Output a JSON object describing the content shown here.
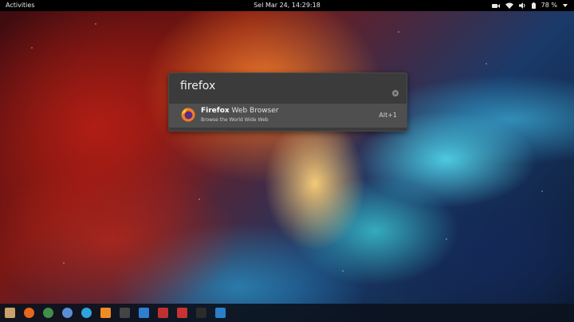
{
  "topbar": {
    "activities": "Activities",
    "clock": "Sel Mar 24, 14:29:18",
    "battery": "78 %"
  },
  "search": {
    "query": "firefox"
  },
  "result": {
    "name_match": "Firefox",
    "name_rest": " Web Browser",
    "description": "Browse the World Wide Web",
    "shortcut": "Alt+1"
  },
  "colors": {
    "panel_bg": "#3b3b3b",
    "row_selected": "#4f4f4f",
    "topbar_bg": "#000000"
  },
  "dock": {
    "items": [
      {
        "icon": "files-icon",
        "color": "#c9a36a"
      },
      {
        "icon": "firefox-icon",
        "color": "#e8671c"
      },
      {
        "icon": "chrome-icon",
        "color": "#3f8f4a"
      },
      {
        "icon": "chromium-icon",
        "color": "#5a8fd6"
      },
      {
        "icon": "telegram-icon",
        "color": "#2ea3dd"
      },
      {
        "icon": "sublime-icon",
        "color": "#f08a24"
      },
      {
        "icon": "inkscape-icon",
        "color": "#444444"
      },
      {
        "icon": "app-icon",
        "color": "#2f7fd0"
      },
      {
        "icon": "screenshot-icon",
        "color": "#c03030"
      },
      {
        "icon": "sheets-icon",
        "color": "#c83232"
      },
      {
        "icon": "terminal-icon",
        "color": "#2b2b2b"
      },
      {
        "icon": "vm-icon",
        "color": "#2b7fc8"
      }
    ]
  }
}
